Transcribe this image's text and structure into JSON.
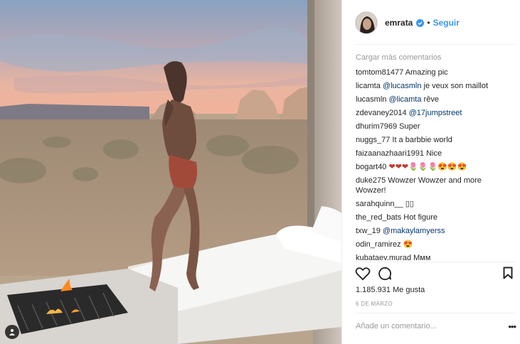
{
  "post": {
    "username": "emrata",
    "separator": "•",
    "follow_label": "Seguir",
    "load_more": "Cargar más comentarios",
    "likes": "1.185.931 Me gusta",
    "date": "6 DE MARZO",
    "add_comment_placeholder": "Añade un comentario...",
    "more_label": "•••"
  },
  "comments": [
    {
      "user": "tomtom81477",
      "text": "Amazing pic"
    },
    {
      "user": "licamta",
      "mention": "@lucasmln",
      "text": "je veux son maillot"
    },
    {
      "user": "lucasmln",
      "mention": "@licamta",
      "text": "rêve"
    },
    {
      "user": "zdevaney2014",
      "mention": "@17jumpstreet",
      "text": ""
    },
    {
      "user": "dhurim7969",
      "text": "Super"
    },
    {
      "user": "nuggs_77",
      "text": "It a barbbie world"
    },
    {
      "user": "faizaanazhaari1991",
      "text": "Nice"
    },
    {
      "user": "bogart40",
      "text": "❤❤❤🌷🌷🌷😍😍😍"
    },
    {
      "user": "duke275",
      "text": "Wowzer Wowzer and more Wowzer!"
    },
    {
      "user": "sarahquinn__",
      "text": "▯▯"
    },
    {
      "user": "the_red_bats",
      "text": "Hot figure"
    },
    {
      "user": "txw_19",
      "mention": "@makaylamyerss",
      "text": ""
    },
    {
      "user": "odin_ramirez",
      "text": "😍"
    },
    {
      "user": "kubataev.murad",
      "text": "Ммм"
    }
  ],
  "icons": {
    "like": "heart-icon",
    "comment": "comment-icon",
    "save": "bookmark-icon",
    "verified": "verified-badge-icon",
    "tag": "user-tag-icon"
  },
  "colors": {
    "link": "#3897f0",
    "mention": "#003569",
    "muted": "#999999"
  }
}
